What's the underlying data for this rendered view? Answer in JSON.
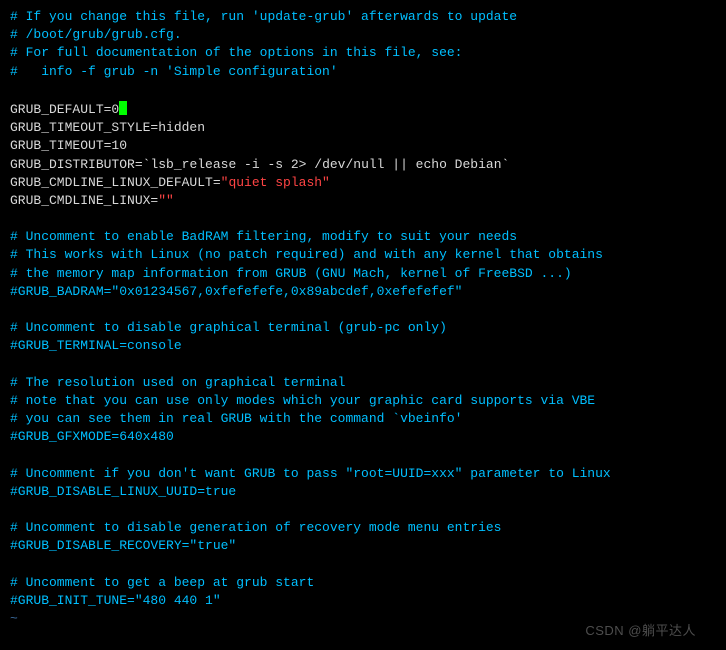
{
  "c1": "# If you change this file, run 'update-grub' afterwards to update",
  "c2": "# /boot/grub/grub.cfg.",
  "c3": "# For full documentation of the options in this file, see:",
  "c4": "#   info -f grub -n 'Simple configuration'",
  "g_default": "GRUB_DEFAULT=0",
  "g_to_style": "GRUB_TIMEOUT_STYLE=hidden",
  "g_to": "GRUB_TIMEOUT=10",
  "g_dist_pre": "GRUB_DISTRIBUTOR=",
  "backtick": "`",
  "g_dist_cmd": "lsb_release -i -s 2> /dev/null || echo Debian",
  "g_cmd_def_pre": "GRUB_CMDLINE_LINUX_DEFAULT=",
  "quiet_splash": "\"quiet splash\"",
  "g_cmd_lin_pre": "GRUB_CMDLINE_LINUX=",
  "empty_str": "\"\"",
  "b1": "# Uncomment to enable BadRAM filtering, modify to suit your needs",
  "b2": "# This works with Linux (no patch required) and with any kernel that obtains",
  "b3": "# the memory map information from GRUB (GNU Mach, kernel of FreeBSD ...)",
  "badram": "#GRUB_BADRAM=\"0x01234567,0xfefefefe,0x89abcdef,0xefefefef\"",
  "t1": "# Uncomment to disable graphical terminal (grub-pc only)",
  "term_console": "#GRUB_TERMINAL=console",
  "r1": "# The resolution used on graphical terminal",
  "r2": "# note that you can use only modes which your graphic card supports via VBE",
  "r3": "# you can see them in real GRUB with the command `vbeinfo'",
  "gfx": "#GRUB_GFXMODE=640x480",
  "u1": "# Uncomment if you don't want GRUB to pass \"root=UUID=xxx\" parameter to Linux",
  "uuid": "#GRUB_DISABLE_LINUX_UUID=true",
  "rc1": "# Uncomment to disable generation of recovery mode menu entries",
  "recov": "#GRUB_DISABLE_RECOVERY=\"true\"",
  "bp1": "# Uncomment to get a beep at grub start",
  "tune": "#GRUB_INIT_TUNE=\"480 440 1\"",
  "vim_eob": "~",
  "watermark": "CSDN @躺平达人"
}
